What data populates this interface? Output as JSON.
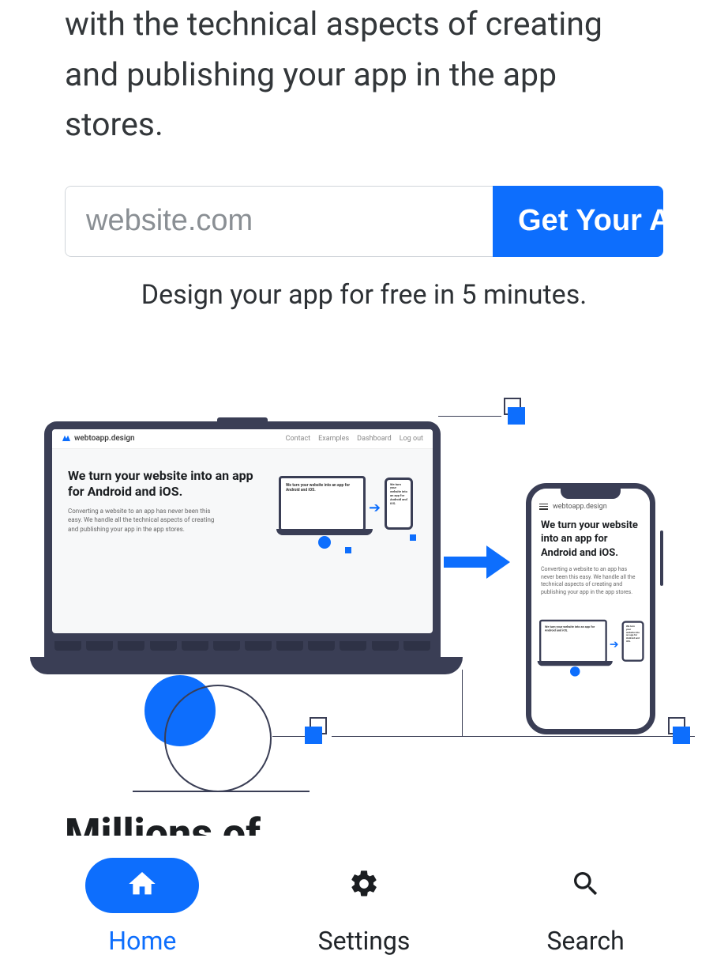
{
  "hero": {
    "text_fragment": "with the technical aspects of creating and publishing your app in the app stores."
  },
  "form": {
    "placeholder": "website.com",
    "button": "Get Your App",
    "tagline": "Design your app for free in 5 minutes."
  },
  "illustration": {
    "brand": "webtoapp.design",
    "nav": [
      "Contact",
      "Examples",
      "Dashboard",
      "Log out"
    ],
    "headline": "We turn your website into an app for Android and iOS.",
    "subtext": "Converting a website to an app has never been this easy. We handle all the technical aspects of creating and publishing your app in the app stores.",
    "tiny_lap": "We turn your website into an app for Android and iOS.",
    "tiny_phone": "We turn your website into an app for Android and iOS."
  },
  "next_section_heading_partial": "Millions of",
  "bottom_nav": {
    "items": [
      {
        "label": "Home",
        "icon": "home-icon",
        "active": true
      },
      {
        "label": "Settings",
        "icon": "gear-icon",
        "active": false
      },
      {
        "label": "Search",
        "icon": "search-icon",
        "active": false
      }
    ]
  },
  "colors": {
    "accent": "#0d6efd",
    "dark": "#3a3e55"
  }
}
